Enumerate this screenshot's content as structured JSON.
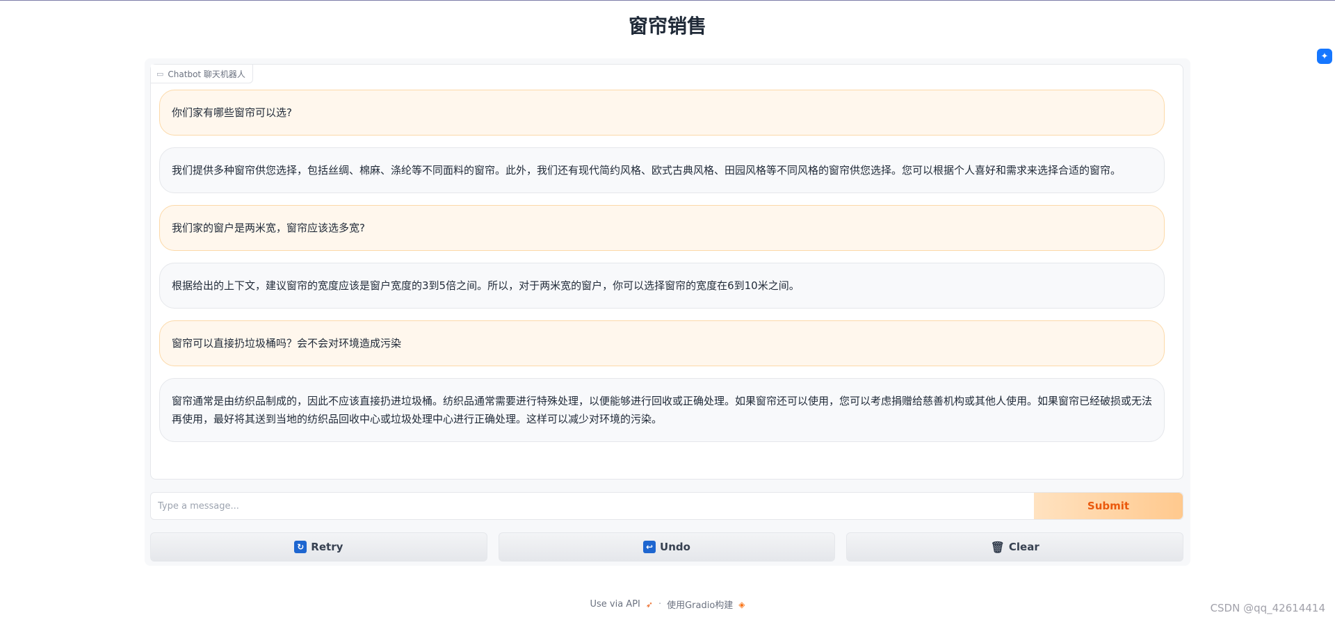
{
  "app": {
    "title": "窗帘销售"
  },
  "chatbot": {
    "label": "Chatbot 聊天机器人",
    "messages": [
      {
        "role": "user",
        "text": "你们家有哪些窗帘可以选?"
      },
      {
        "role": "bot",
        "text": "我们提供多种窗帘供您选择，包括丝绸、棉麻、涤纶等不同面料的窗帘。此外，我们还有现代简约风格、欧式古典风格、田园风格等不同风格的窗帘供您选择。您可以根据个人喜好和需求来选择合适的窗帘。"
      },
      {
        "role": "user",
        "text": "我们家的窗户是两米宽，窗帘应该选多宽?"
      },
      {
        "role": "bot",
        "text": "根据给出的上下文，建议窗帘的宽度应该是窗户宽度的3到5倍之间。所以，对于两米宽的窗户，你可以选择窗帘的宽度在6到10米之间。"
      },
      {
        "role": "user",
        "text": "窗帘可以直接扔垃圾桶吗？会不会对环境造成污染"
      },
      {
        "role": "bot",
        "text": "窗帘通常是由纺织品制成的，因此不应该直接扔进垃圾桶。纺织品通常需要进行特殊处理，以便能够进行回收或正确处理。如果窗帘还可以使用，您可以考虑捐赠给慈善机构或其他人使用。如果窗帘已经破损或无法再使用，最好将其送到当地的纺织品回收中心或垃圾处理中心进行正确处理。这样可以减少对环境的污染。"
      }
    ]
  },
  "input": {
    "placeholder": "Type a message...",
    "value": ""
  },
  "buttons": {
    "submit": "Submit",
    "retry": "Retry",
    "undo": "Undo",
    "clear": "Clear"
  },
  "footer": {
    "api": "Use via API",
    "separator": "·",
    "built": "使用Gradio构建"
  },
  "watermark": "CSDN @qq_42614414",
  "colors": {
    "accent": "#ea580c",
    "user_bubble": "#fff7ed",
    "bot_bubble": "#f8f9fb"
  },
  "icons": {
    "chatbot": "chat-icon",
    "retry": "refresh-icon",
    "undo": "undo-icon",
    "clear": "trash-icon",
    "api": "rocket-icon",
    "gradio": "gradio-logo-icon"
  }
}
